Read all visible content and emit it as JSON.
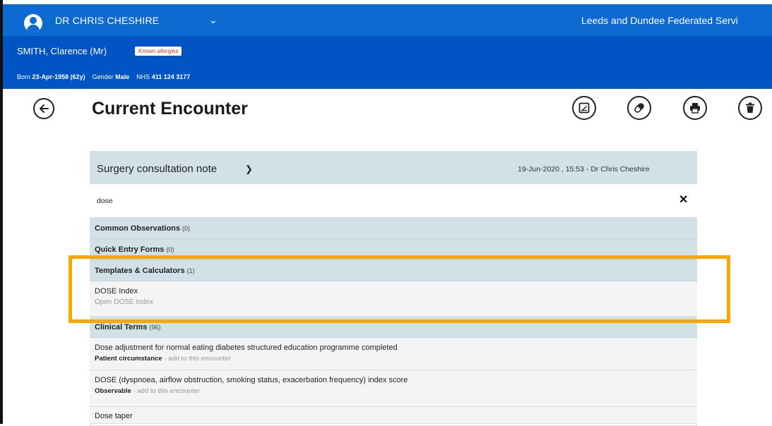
{
  "topbar": {
    "user_name": "DR CHRIS CHESHIRE",
    "organisation": "Leeds and Dundee Federated Servi"
  },
  "patient": {
    "name": "SMITH, Clarence (Mr)",
    "allergy_badge": "Known allergies",
    "born_label": "Born",
    "born_value": "23-Apr-1958 (62y)",
    "gender_label": "Gender",
    "gender_value": "Male",
    "nhs_label": "NHS",
    "nhs_value": "411 124 3177"
  },
  "page": {
    "title": "Current Encounter"
  },
  "toolbar": {
    "icons": [
      "notes-icon",
      "medication-icon",
      "print-icon",
      "delete-icon"
    ]
  },
  "note": {
    "type": "Surgery consultation note",
    "meta": "19-Jun-2020 , 15:53 - Dr Chris Cheshire"
  },
  "search": {
    "value": "dose"
  },
  "sections": {
    "common_observations": {
      "label": "Common Observations",
      "count": "(0)"
    },
    "quick_entry_forms": {
      "label": "Quick Entry Forms",
      "count": "(0)"
    },
    "templates_calculators": {
      "label": "Templates & Calculators",
      "count": "(1)"
    },
    "clinical_terms": {
      "label": "Clinical Terms",
      "count": "(96)"
    }
  },
  "template_results": [
    {
      "title": "DOSE Index",
      "subtitle": "Open DOSE Index"
    }
  ],
  "clinical_results": [
    {
      "title": "Dose adjustment for normal eating diabetes structured education programme completed",
      "category": "Patient circumstance",
      "action": "add to this encounter"
    },
    {
      "title": "DOSE (dyspnoea, airflow obstruction, smoking status, exacerbation frequency) index score",
      "category": "Observable",
      "action": "add to this encounter"
    },
    {
      "title": "Dose taper",
      "category": "",
      "action": ""
    }
  ],
  "colors": {
    "topbar": "#0c6ad1",
    "patientbar": "#0054c4",
    "section": "#d2e1e8",
    "highlight": "#f5a800"
  }
}
